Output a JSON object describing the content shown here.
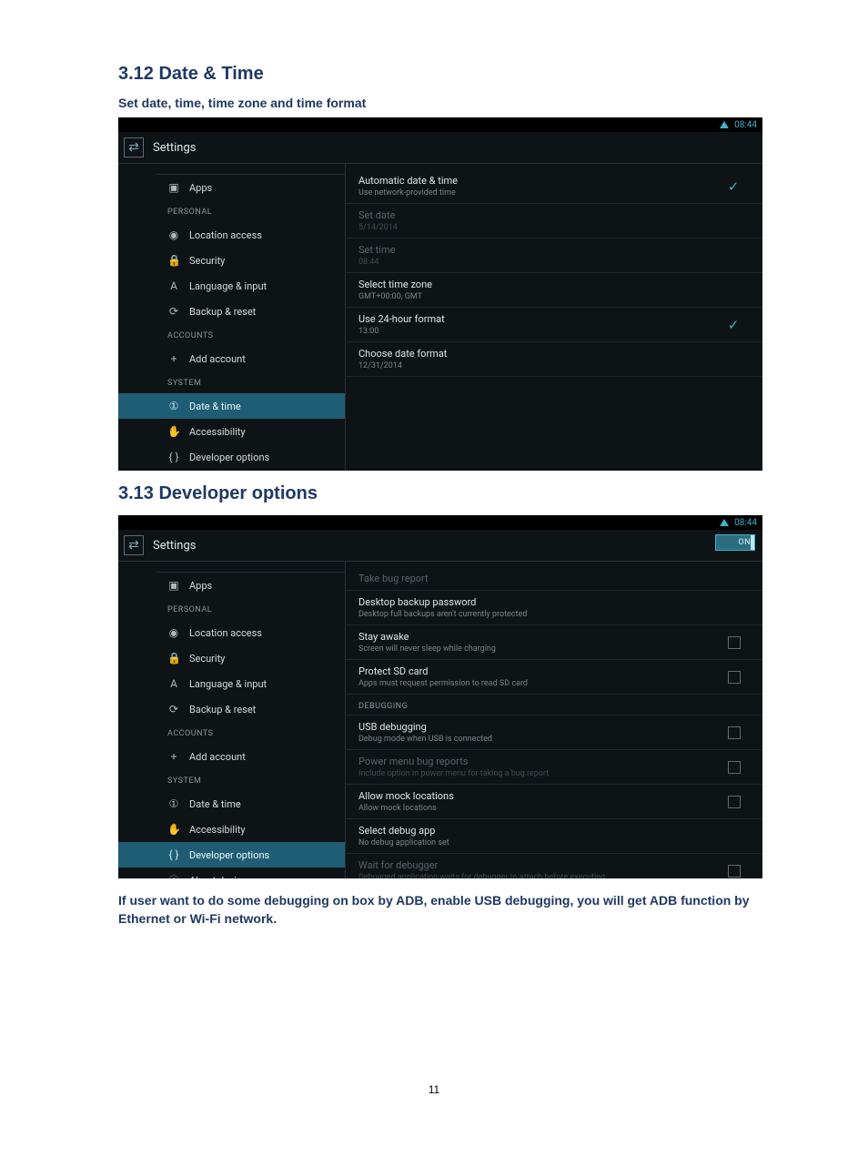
{
  "doc": {
    "heading_312": "3.12 Date & Time",
    "sub_312": "Set date, time, time zone and time format",
    "heading_313": "3.13 Developer options",
    "body_313": "If user want to do some debugging on box by ADB, enable USB debugging, you will get ADB function by Ethernet or Wi-Fi network.",
    "page_number": "11"
  },
  "common": {
    "status_time": "08:44",
    "settings_title": "Settings",
    "on_label": "ON"
  },
  "sidebar": {
    "items": [
      {
        "icon": "▣",
        "label": "Apps",
        "name": "sidebar-item-apps"
      },
      {
        "cat": "PERSONAL"
      },
      {
        "icon": "◉",
        "label": "Location access",
        "name": "sidebar-item-location"
      },
      {
        "icon": "🔒",
        "label": "Security",
        "name": "sidebar-item-security"
      },
      {
        "icon": "A",
        "label": "Language & input",
        "name": "sidebar-item-language"
      },
      {
        "icon": "⟳",
        "label": "Backup & reset",
        "name": "sidebar-item-backup"
      },
      {
        "cat": "ACCOUNTS"
      },
      {
        "icon": "+",
        "label": "Add account",
        "name": "sidebar-item-add-account"
      },
      {
        "cat": "SYSTEM"
      },
      {
        "icon": "①",
        "label": "Date & time",
        "name": "sidebar-item-datetime"
      },
      {
        "icon": "✋",
        "label": "Accessibility",
        "name": "sidebar-item-accessibility"
      },
      {
        "icon": "{ }",
        "label": "Developer options",
        "name": "sidebar-item-developer"
      },
      {
        "icon": "ⓘ",
        "label": "About device",
        "name": "sidebar-item-about"
      }
    ]
  },
  "datetime_panel": {
    "rows": [
      {
        "t1": "Automatic date & time",
        "t2": "Use network-provided time",
        "check": "tick"
      },
      {
        "t1": "Set date",
        "t2": "5/14/2014",
        "disabled": true
      },
      {
        "t1": "Set time",
        "t2": "08:44",
        "disabled": true
      },
      {
        "t1": "Select time zone",
        "t2": "GMT+00:00, GMT"
      },
      {
        "t1": "Use 24-hour format",
        "t2": "13:00",
        "check": "tick"
      },
      {
        "t1": "Choose date format",
        "t2": "12/31/2014"
      }
    ]
  },
  "dev_panel": {
    "rows": [
      {
        "t1": "Take bug report",
        "disabled": true
      },
      {
        "t1": "Desktop backup password",
        "t2": "Desktop full backups aren't currently protected"
      },
      {
        "t1": "Stay awake",
        "t2": "Screen will never sleep while charging",
        "check": "box"
      },
      {
        "t1": "Protect SD card",
        "t2": "Apps must request permission to read SD card",
        "check": "box"
      },
      {
        "cat": "DEBUGGING"
      },
      {
        "t1": "USB debugging",
        "t2": "Debug mode when USB is connected",
        "check": "box"
      },
      {
        "t1": "Power menu bug reports",
        "t2": "Include option in power menu for taking a bug report",
        "disabled": true,
        "check": "box"
      },
      {
        "t1": "Allow mock locations",
        "t2": "Allow mock locations",
        "check": "box"
      },
      {
        "t1": "Select debug app",
        "t2": "No debug application set"
      },
      {
        "t1": "Wait for debugger",
        "t2": "Debugged application waits for debugger to attach before executing",
        "disabled": true,
        "check": "box"
      }
    ]
  }
}
